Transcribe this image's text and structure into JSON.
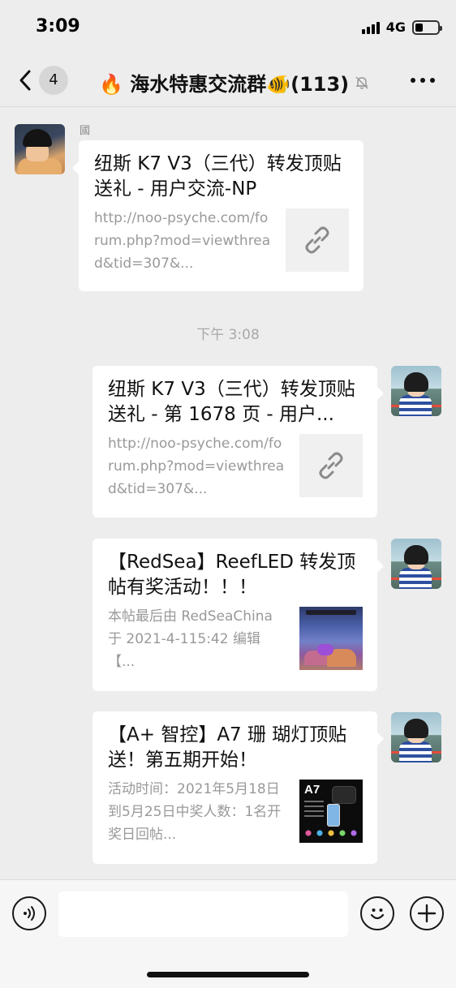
{
  "status_bar": {
    "time": "3:09",
    "network": "4G",
    "battery_level": 0.35
  },
  "nav": {
    "back_count": "4",
    "title": "🔥 海水特惠交流群🐠(113)",
    "icons": [
      "chevron-left-icon",
      "mute-bell-icon",
      "more-icon"
    ]
  },
  "messages": [
    {
      "side": "left",
      "sender": "國",
      "title": "纽斯 K7 V3（三代）转发顶贴送礼 - 用户交流-NP",
      "desc": "http://noo-psyche.com/forum.php?mod=viewthread&tid=307&...",
      "thumb": "link-icon"
    },
    {
      "side": "right",
      "title": "纽斯 K7 V3（三代）转发顶贴送礼 - 第 1678 页 - 用户...",
      "desc": "http://noo-psyche.com/forum.php?mod=viewthread&tid=307&...",
      "thumb": "link-icon"
    },
    {
      "side": "right",
      "title": "【RedSea】ReefLED 转发顶帖有奖活动！！！",
      "desc": "本帖最后由 RedSeaChina 于 2021-4-115:42 编辑【...",
      "thumb": "reef-aquarium-image"
    },
    {
      "side": "right",
      "title": "【A+ 智控】A7 珊 瑚灯顶贴送！第五期开始！",
      "desc": "活动时间：2021年5月18日到5月25日中奖人数：1名开奖日回帖...",
      "thumb": "a7-product-image",
      "thumb_label": "A7"
    }
  ],
  "time_divider": "下午 3:08",
  "input_bar": {
    "placeholder": "",
    "icons": [
      "voice-icon",
      "emoji-icon",
      "plus-icon"
    ]
  }
}
